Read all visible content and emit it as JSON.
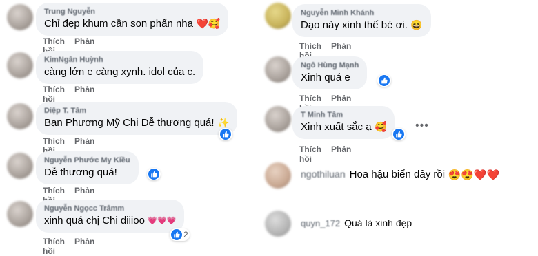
{
  "actions": {
    "like": "Thích",
    "reply": "Phản hồi"
  },
  "left_comments": [
    {
      "name": "Trung Nguyễn",
      "text": "Chỉ đẹp khum cần son phấn nha",
      "emojis": "❤️🥰"
    },
    {
      "name": "KimNgân Huỳnh",
      "text": "càng lớn e càng xynh. idol của c."
    },
    {
      "name": "Diệp T. Tâm",
      "text": "Bạn Phương Mỹ Chi Dễ thương quá!",
      "emojis": "✨"
    },
    {
      "name": "Nguyễn Phước My Kiều",
      "text": "Dễ thương quá!"
    },
    {
      "name": "Nguyễn Ngọcc Trâmm",
      "text": "xinh quá chị Chi điiioo",
      "emojis": "💗💗💗",
      "reaction_count": "2"
    }
  ],
  "right_comments": [
    {
      "name": "Nguyễn Minh Khánh",
      "text": "Dạo này xinh thế bé ơi.",
      "emojis": "😆"
    },
    {
      "name": "Ngô Hùng Mạnh",
      "text": "Xinh quá e"
    },
    {
      "name": "T Minh Tâm",
      "text": "Xinh xuất sắc ạ",
      "emojis": "🥰",
      "more": "•••"
    }
  ],
  "right_plain": [
    {
      "name": "ngothiluan",
      "text": "Hoa hậu biển đây rồi",
      "emojis": "😍😍❤️❤️"
    },
    {
      "name": "quyn_172",
      "text": "Quá là xinh đẹp"
    }
  ]
}
